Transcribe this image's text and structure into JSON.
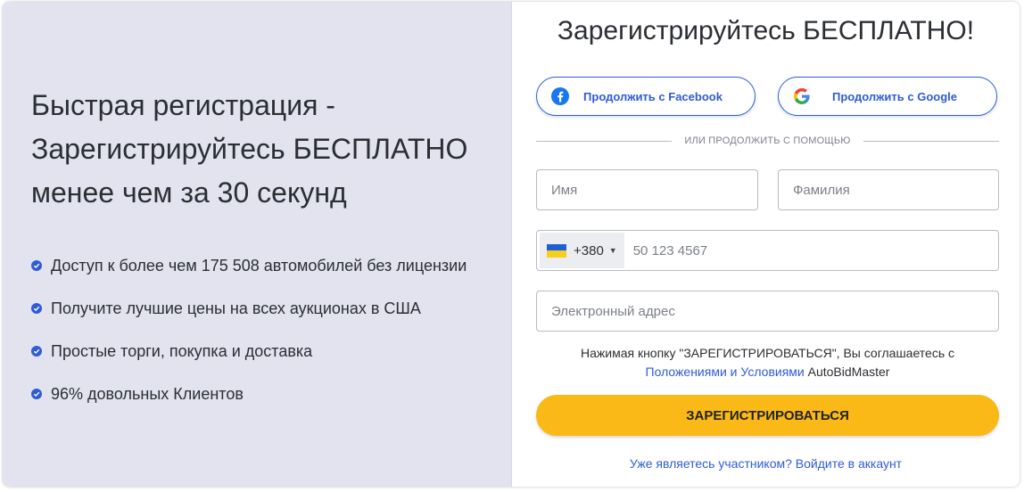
{
  "left": {
    "headline": "Быстрая регистрация - Зарегистрируйтесь БЕСПЛАТНО менее чем за 30 секунд",
    "features": [
      "Доступ к более чем 175 508 автомобилей без лицензии",
      "Получите лучшие цены на всех аукционах в США",
      "Простые торги, покупка и доставка",
      "96% довольных Клиентов"
    ]
  },
  "form": {
    "title": "Зарегистрируйтесь БЕСПЛАТНО!",
    "facebook_label": "Продолжить с Facebook",
    "google_label": "Продолжить с Google",
    "divider_text": "ИЛИ ПРОДОЛЖИТЬ С ПОМОЩЬЮ",
    "first_name_placeholder": "Имя",
    "last_name_placeholder": "Фамилия",
    "phone_country_code": "+380",
    "phone_placeholder": "50 123 4567",
    "email_placeholder": "Электронный адрес",
    "terms_prefix": "Нажимая кнопку \"ЗАРЕГИСТРИРОВАТЬСЯ\", Вы соглашаетесь с",
    "terms_link": "Положениями и Условиями",
    "terms_suffix": "AutoBidMaster",
    "submit_label": "ЗАРЕГИСТРИРОВАТЬСЯ",
    "login_link": "Уже являетесь участником? Войдите в аккаунт"
  },
  "colors": {
    "accent": "#2f5cd6",
    "submit": "#fbb917",
    "left_panel": "#e2e3ee"
  },
  "icons": [
    "check-icon",
    "facebook-icon",
    "google-icon",
    "flag-ukraine-icon",
    "caret-down-icon"
  ]
}
